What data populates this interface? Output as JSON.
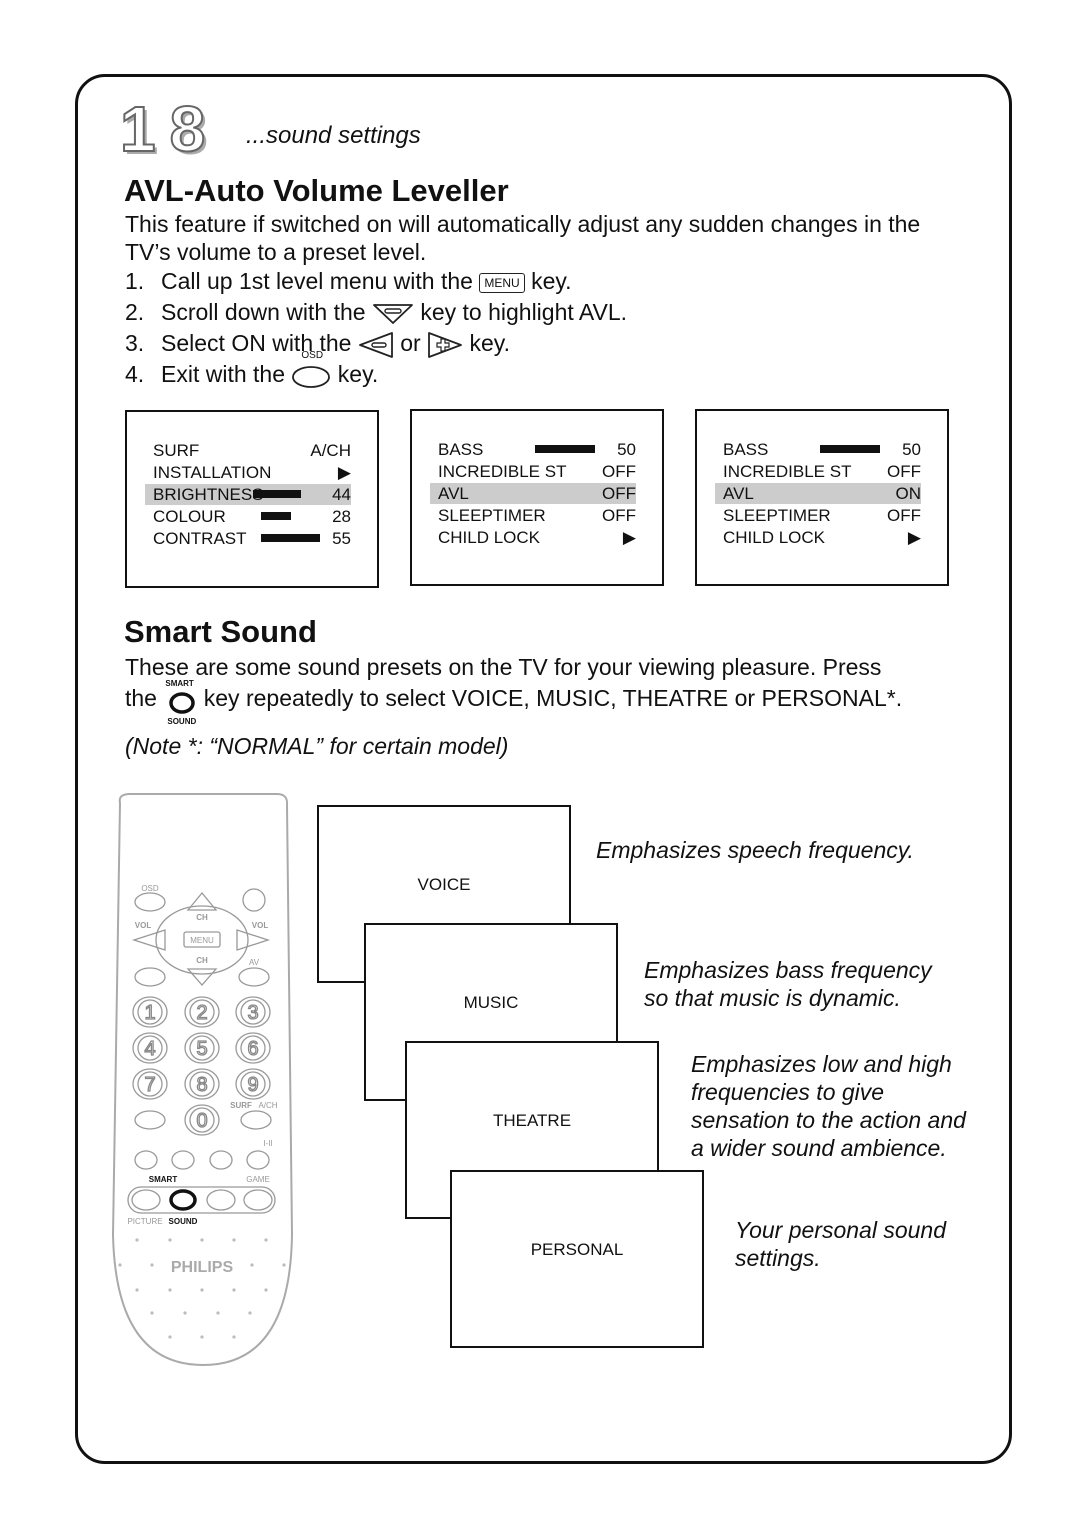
{
  "header": {
    "page_number": "18",
    "section": "...sound settings"
  },
  "avl": {
    "title": "AVL-Auto Volume Leveller",
    "intro": "This feature if switched on will automatically adjust any sudden changes in the TV’s volume to a preset level.",
    "steps": [
      {
        "n": "1.",
        "pre": "Call up 1st level menu with the",
        "key": "MENU",
        "post": "key."
      },
      {
        "n": "2.",
        "pre": "Scroll down with the",
        "post": "key to highlight AVL."
      },
      {
        "n": "3.",
        "pre": "Select ON with the",
        "mid": "or",
        "post": "key."
      },
      {
        "n": "4.",
        "pre": "Exit with the",
        "key": "OSD",
        "post": "key."
      }
    ],
    "menus": [
      {
        "rows": [
          {
            "label": "SURF",
            "value": "A/CH"
          },
          {
            "label": "INSTALLATION",
            "value": "▶"
          },
          {
            "label": "BRIGHTNESS",
            "value": "44",
            "bar": 44,
            "highlight": true
          },
          {
            "label": "COLOUR",
            "value": "28",
            "bar": 28
          },
          {
            "label": "CONTRAST",
            "value": "55",
            "bar": 55
          }
        ]
      },
      {
        "rows": [
          {
            "label": "BASS",
            "value": "50",
            "bar": 50
          },
          {
            "label": "INCREDIBLE ST",
            "value": "OFF"
          },
          {
            "label": "AVL",
            "value": "OFF",
            "highlight": true
          },
          {
            "label": "SLEEPTIMER",
            "value": "OFF"
          },
          {
            "label": "CHILD LOCK",
            "value": "▶"
          }
        ]
      },
      {
        "rows": [
          {
            "label": "BASS",
            "value": "50",
            "bar": 50
          },
          {
            "label": "INCREDIBLE ST",
            "value": "OFF"
          },
          {
            "label": "AVL",
            "value": "ON",
            "highlight": true
          },
          {
            "label": "SLEEPTIMER",
            "value": "OFF"
          },
          {
            "label": "CHILD LOCK",
            "value": "▶"
          }
        ]
      }
    ]
  },
  "smart": {
    "title": "Smart Sound",
    "line1": "These are some sound presets on the TV for your viewing pleasure.  Press",
    "line2_pre": "the",
    "key_top": "SMART",
    "key_bottom": "SOUND",
    "line2_post": "key repeatedly to select VOICE, MUSIC, THEATRE or PERSONAL*.",
    "note": "(Note *: “NORMAL” for certain model)",
    "presets": [
      {
        "label": "VOICE",
        "desc": [
          "Emphasizes speech frequency."
        ]
      },
      {
        "label": "MUSIC",
        "desc": [
          "Emphasizes bass frequency",
          "so that music is dynamic."
        ]
      },
      {
        "label": "THEATRE",
        "desc": [
          "Emphasizes low and high",
          "frequencies to give",
          "sensation to the action and",
          "a wider sound ambience."
        ]
      },
      {
        "label": "PERSONAL",
        "desc": [
          "Your personal sound",
          "settings."
        ]
      }
    ]
  },
  "remote": {
    "brand": "PHILIPS",
    "osd": "OSD",
    "ch": "CH",
    "vol": "VOL",
    "menu": "MENU",
    "av": "AV",
    "digits": [
      "1",
      "2",
      "3",
      "4",
      "5",
      "6",
      "7",
      "8",
      "9",
      "0"
    ],
    "surf": "SURF",
    "ach": "A/CH",
    "dual": "I-II",
    "smart": "SMART",
    "game": "GAME",
    "picture": "PICTURE",
    "sound": "SOUND",
    "highlight_button": "SOUND"
  }
}
